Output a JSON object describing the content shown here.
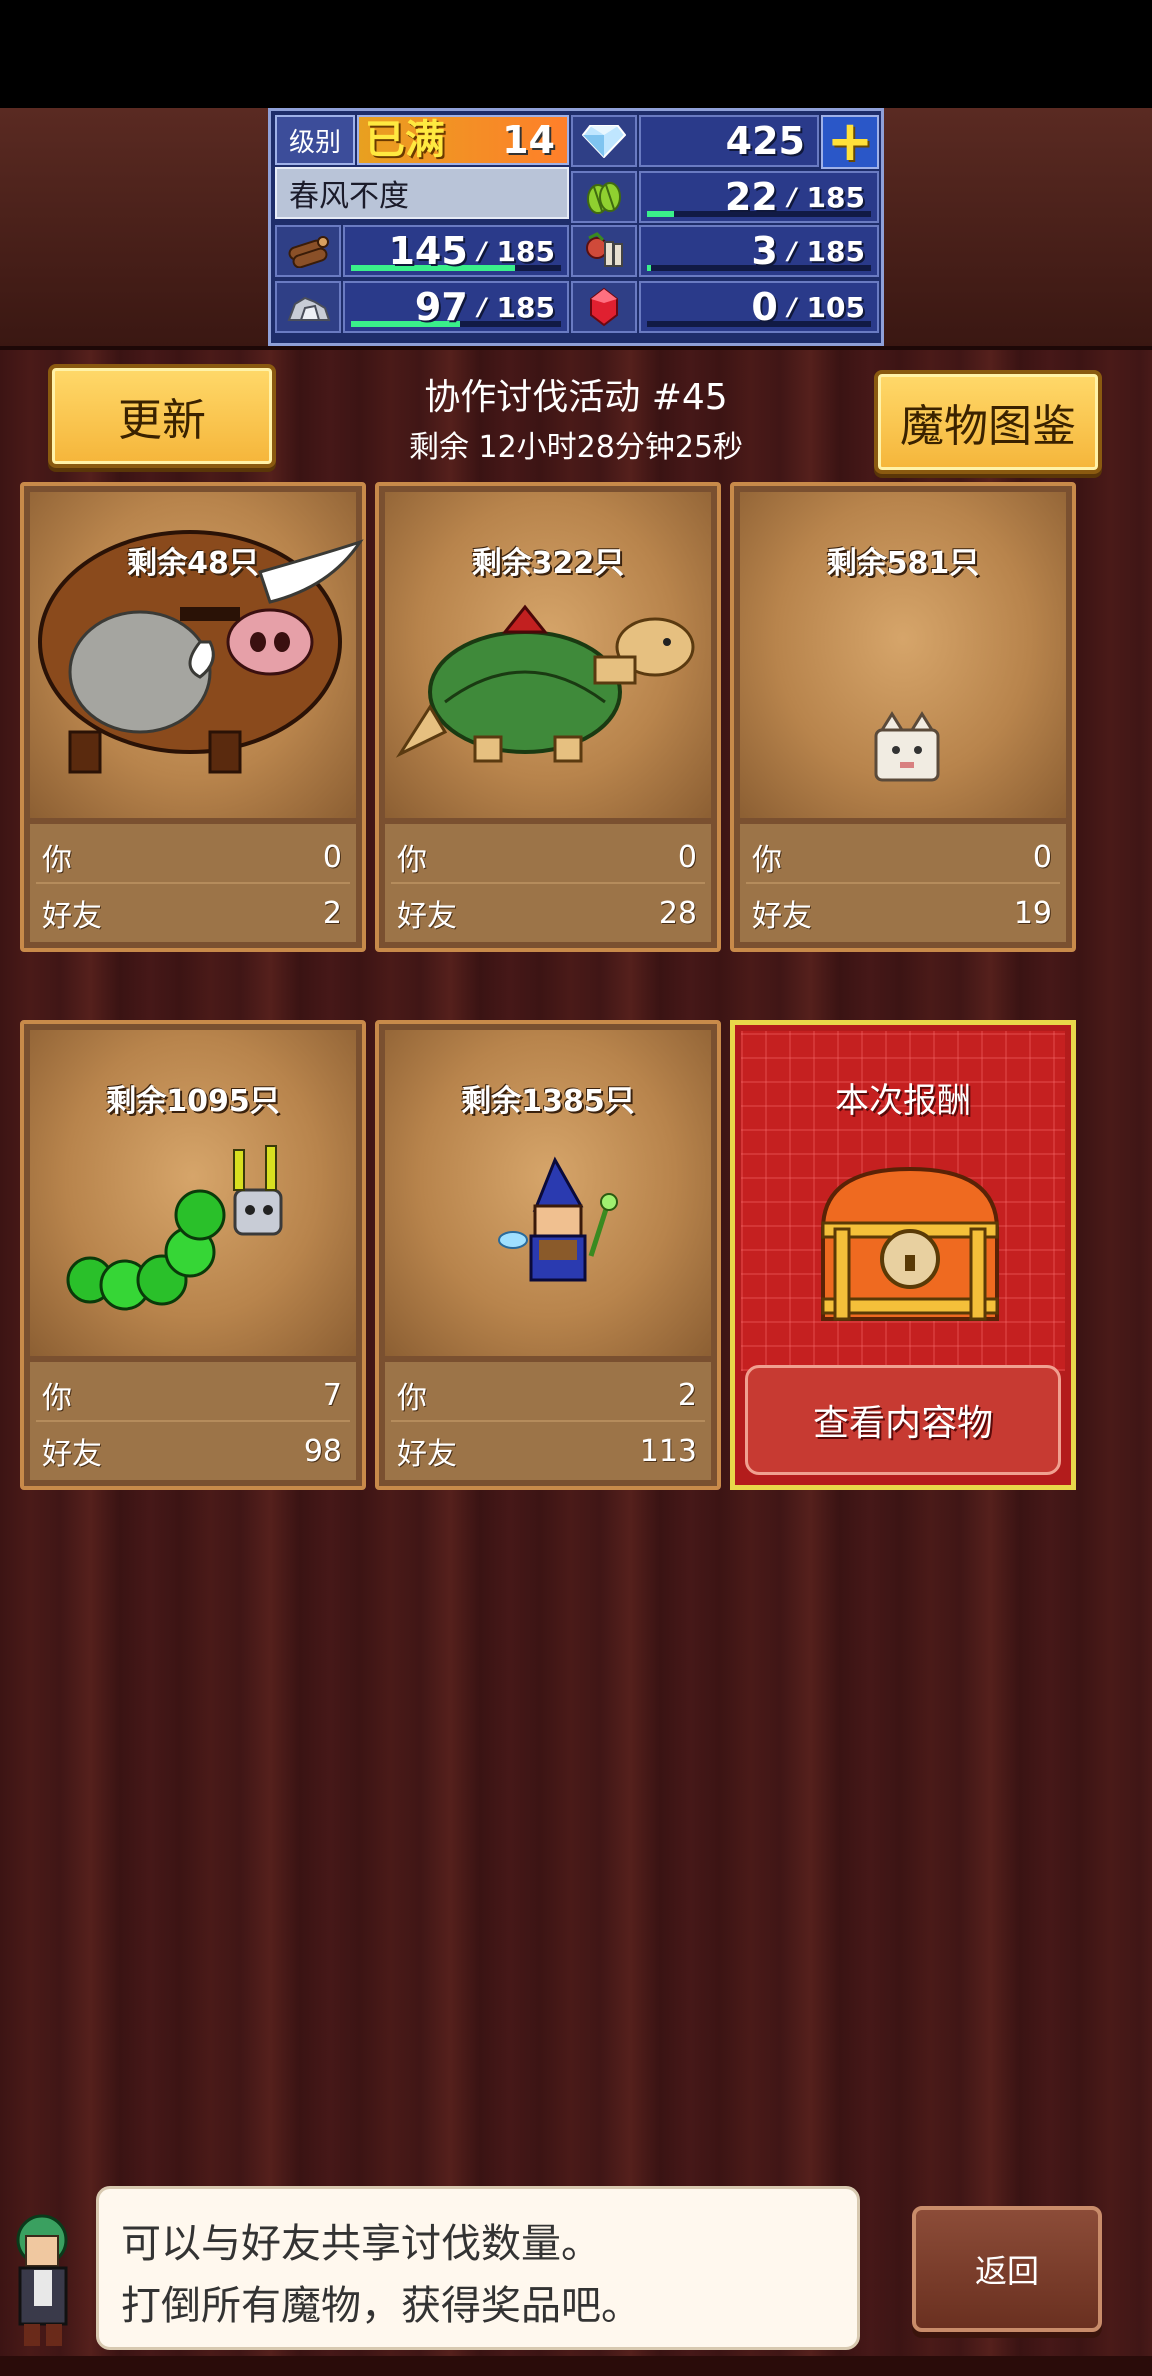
{
  "status": {
    "level_label": "级别",
    "level_max": "已满",
    "level_value": "14",
    "gems": "425",
    "plus": "+",
    "player_name": "春风不度",
    "resources": [
      {
        "icon": "grass-icon",
        "value": "22",
        "max": "185",
        "fill": 0.12
      },
      {
        "icon": "wood-icon",
        "value": "145",
        "max": "185",
        "fill": 0.78
      },
      {
        "icon": "food-icon",
        "value": "3",
        "max": "185",
        "fill": 0.02
      },
      {
        "icon": "stone-icon",
        "value": "97",
        "max": "185",
        "fill": 0.52
      },
      {
        "icon": "ruby-icon",
        "value": "0",
        "max": "105",
        "fill": 0.0
      }
    ]
  },
  "header": {
    "refresh_label": "更新",
    "title": "协作讨伐活动 #45",
    "timer": "剩余 12小时28分钟25秒",
    "bestiary_label": "魔物图鉴"
  },
  "monsters": [
    {
      "remain": "剩余48只",
      "you_label": "你",
      "you": "0",
      "friend_label": "好友",
      "friend": "2",
      "kind": "boar"
    },
    {
      "remain": "剩余322只",
      "you_label": "你",
      "you": "0",
      "friend_label": "好友",
      "friend": "28",
      "kind": "turtle"
    },
    {
      "remain": "剩余581只",
      "you_label": "你",
      "you": "0",
      "friend_label": "好友",
      "friend": "19",
      "kind": "tofu"
    },
    {
      "remain": "剩余1095只",
      "you_label": "你",
      "you": "7",
      "friend_label": "好友",
      "friend": "98",
      "kind": "caterpillar"
    },
    {
      "remain": "剩余1385只",
      "you_label": "你",
      "you": "2",
      "friend_label": "好友",
      "friend": "113",
      "kind": "wizard"
    }
  ],
  "reward": {
    "title": "本次报酬",
    "button": "查看内容物"
  },
  "dialog": {
    "line1": "可以与好友共享讨伐数量。",
    "line2": "打倒所有魔物，获得奖品吧。"
  },
  "back_label": "返回",
  "colors": {
    "accent": "#f5b53a",
    "panel": "#1e2d6a",
    "bar": "#3af08a",
    "reward": "#c52020"
  }
}
